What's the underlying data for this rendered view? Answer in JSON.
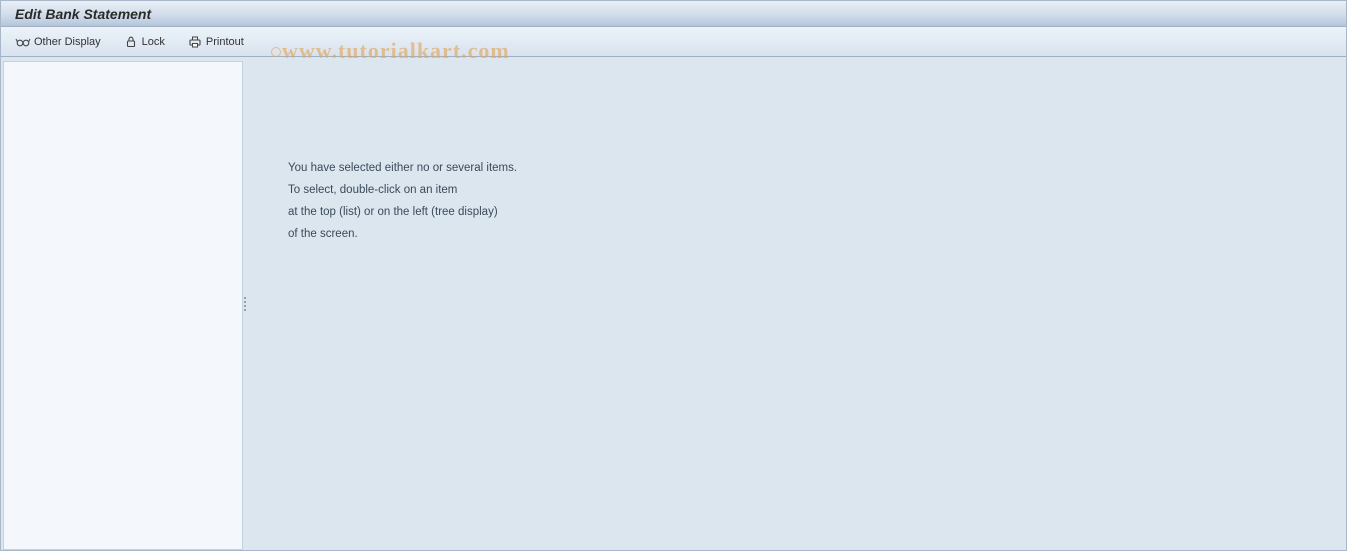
{
  "header": {
    "title": "Edit Bank Statement"
  },
  "toolbar": {
    "other_display_label": "Other Display",
    "lock_label": "Lock",
    "printout_label": "Printout"
  },
  "main": {
    "message_line1": "You have selected either no or several items.",
    "message_line2": "To select, double-click on an item",
    "message_line3": "at the top (list) or on the left (tree display)",
    "message_line4": "of the screen."
  },
  "watermark": {
    "text": "www.tutorialkart.com"
  }
}
